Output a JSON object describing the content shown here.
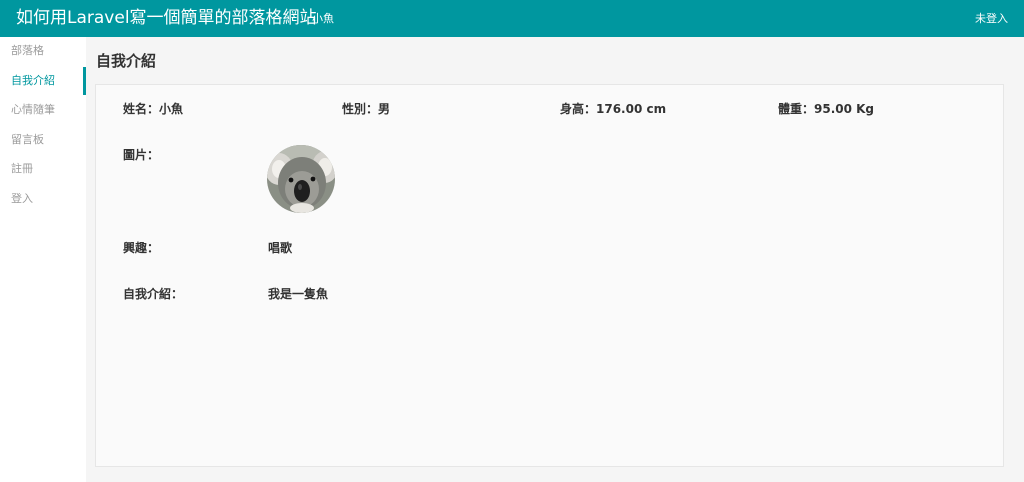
{
  "header": {
    "site_title": "如何用Laravel寫一個簡單的部落格網站",
    "user_name": "小魚",
    "login_status": "未登入"
  },
  "sidebar": {
    "items": [
      {
        "label": "部落格",
        "active": false
      },
      {
        "label": "自我介紹",
        "active": true
      },
      {
        "label": "心情隨筆",
        "active": false
      },
      {
        "label": "留言板",
        "active": false
      },
      {
        "label": "註冊",
        "active": false
      },
      {
        "label": "登入",
        "active": false
      }
    ]
  },
  "main": {
    "page_title": "自我介紹",
    "profile": {
      "name": "姓名：小魚",
      "gender": "性別：男",
      "height": "身高：176.00 cm",
      "weight": "體重：95.00 Kg",
      "picture_label": "圖片：",
      "hobby_label": "興趣：",
      "hobby_value": "唱歌",
      "intro_label": "自我介紹：",
      "intro_value": "我是一隻魚"
    }
  },
  "colors": {
    "accent": "#00979f",
    "background": "#f5f5f5",
    "card_background": "#fafafa"
  }
}
